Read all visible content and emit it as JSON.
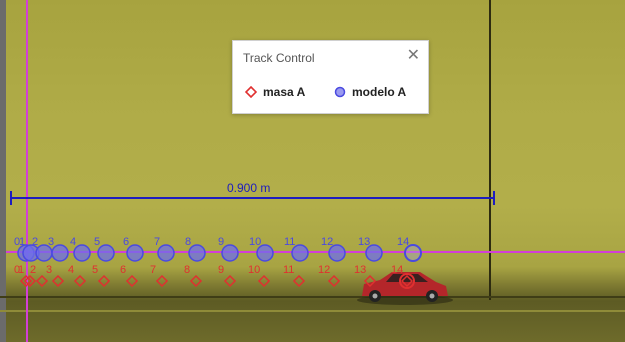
{
  "track_control": {
    "title": "Track Control",
    "close_glyph": "✕",
    "items": [
      {
        "label": "masa A",
        "icon": "red-diamond-icon"
      },
      {
        "label": "modelo A",
        "icon": "blue-circle-icon"
      }
    ]
  },
  "calibration": {
    "label": "0.900 m"
  },
  "model_track": {
    "color": "#4a4ae0",
    "labels": [
      "0",
      "1",
      "2",
      "3",
      "4",
      "5",
      "6",
      "7",
      "8",
      "9",
      "10",
      "11",
      "12",
      "13",
      "14"
    ]
  },
  "mass_track": {
    "color": "#e03030",
    "labels": [
      "0",
      "1",
      "2",
      "3",
      "4",
      "5",
      "6",
      "7",
      "8",
      "9",
      "10",
      "11",
      "12",
      "13",
      "14"
    ]
  }
}
